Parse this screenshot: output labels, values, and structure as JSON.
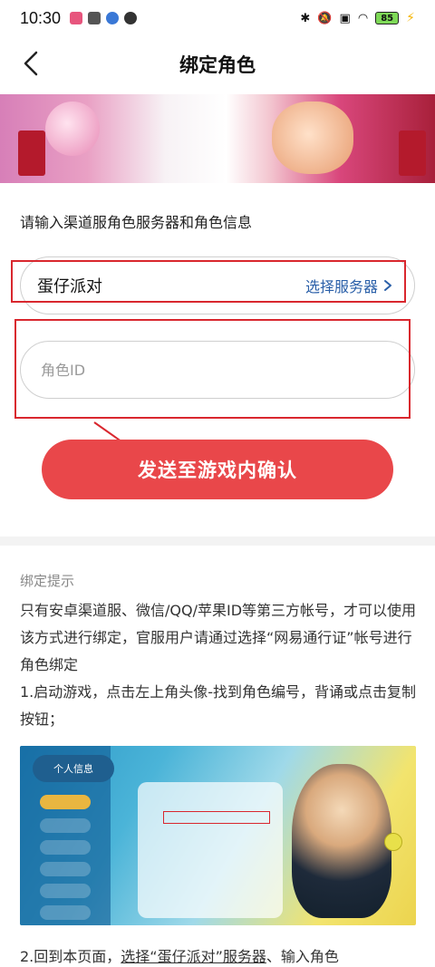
{
  "status_bar": {
    "time": "10:30",
    "battery": "85"
  },
  "header": {
    "title": "绑定角色"
  },
  "form": {
    "section_label": "请输入渠道服角色服务器和角色信息",
    "server_value": "蛋仔派对",
    "select_server_label": "选择服务器",
    "role_id_placeholder": "角色ID",
    "send_button_label": "发送至游戏内确认"
  },
  "tips": {
    "title": "绑定提示",
    "paragraph1": "只有安卓渠道服、微信/QQ/苹果ID等第三方帐号，才可以使用该方式进行绑定，官服用户请通过选择“网易通行证”帐号进行角色绑定",
    "step1": "1.启动游戏，点击左上角头像-找到角色编号，背诵或点击复制按钮；",
    "step2_prefix": "2.回到本页面，",
    "step2_underlined": "选择“蛋仔派对”服务器",
    "step2_suffix": "、输入角色"
  },
  "guide_image": {
    "header_label": "个人信息"
  },
  "colors": {
    "accent_red": "#e9474a",
    "link_blue": "#2a5fa8",
    "annotation_red": "#d9272e"
  }
}
